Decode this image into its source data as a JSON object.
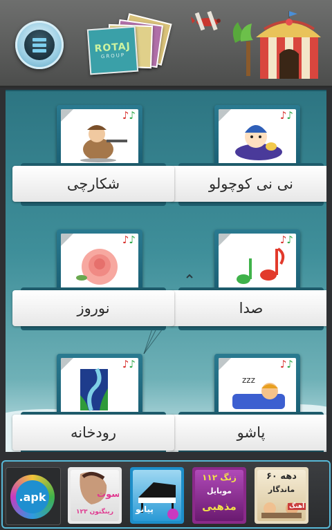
{
  "header": {
    "menu_icon": "menu-list-icon",
    "logo_text": "ROTAJ",
    "logo_subtext": "GROUP"
  },
  "cards": [
    {
      "label": "نی نی کوچولو",
      "icon": "baby-icon"
    },
    {
      "label": "شکارچی",
      "icon": "hunter-icon"
    },
    {
      "label": "صدا",
      "icon": "music-notes-icon"
    },
    {
      "label": "نوروز",
      "icon": "rose-icon"
    },
    {
      "label": "پاشو",
      "icon": "sleeping-boy-icon"
    },
    {
      "label": "رودخانه",
      "icon": "river-icon"
    }
  ],
  "dock": {
    "apk_label": ".apk",
    "app1_title": "سوت",
    "app1_subtitle": "۱۲۳ رینگتون",
    "app2_title": "پیانو",
    "app3_line1": "۱۱۲ زنگ",
    "app3_line2": "موبایل",
    "app3_line3": "مذهبی",
    "app4_line1": "۶۰ دهه",
    "app4_line2": "ماندگار",
    "app4_line3": "آهنگ"
  },
  "colors": {
    "accent": "#58b9d8",
    "content_top": "#2d7582",
    "header": "#5a5b5a"
  }
}
